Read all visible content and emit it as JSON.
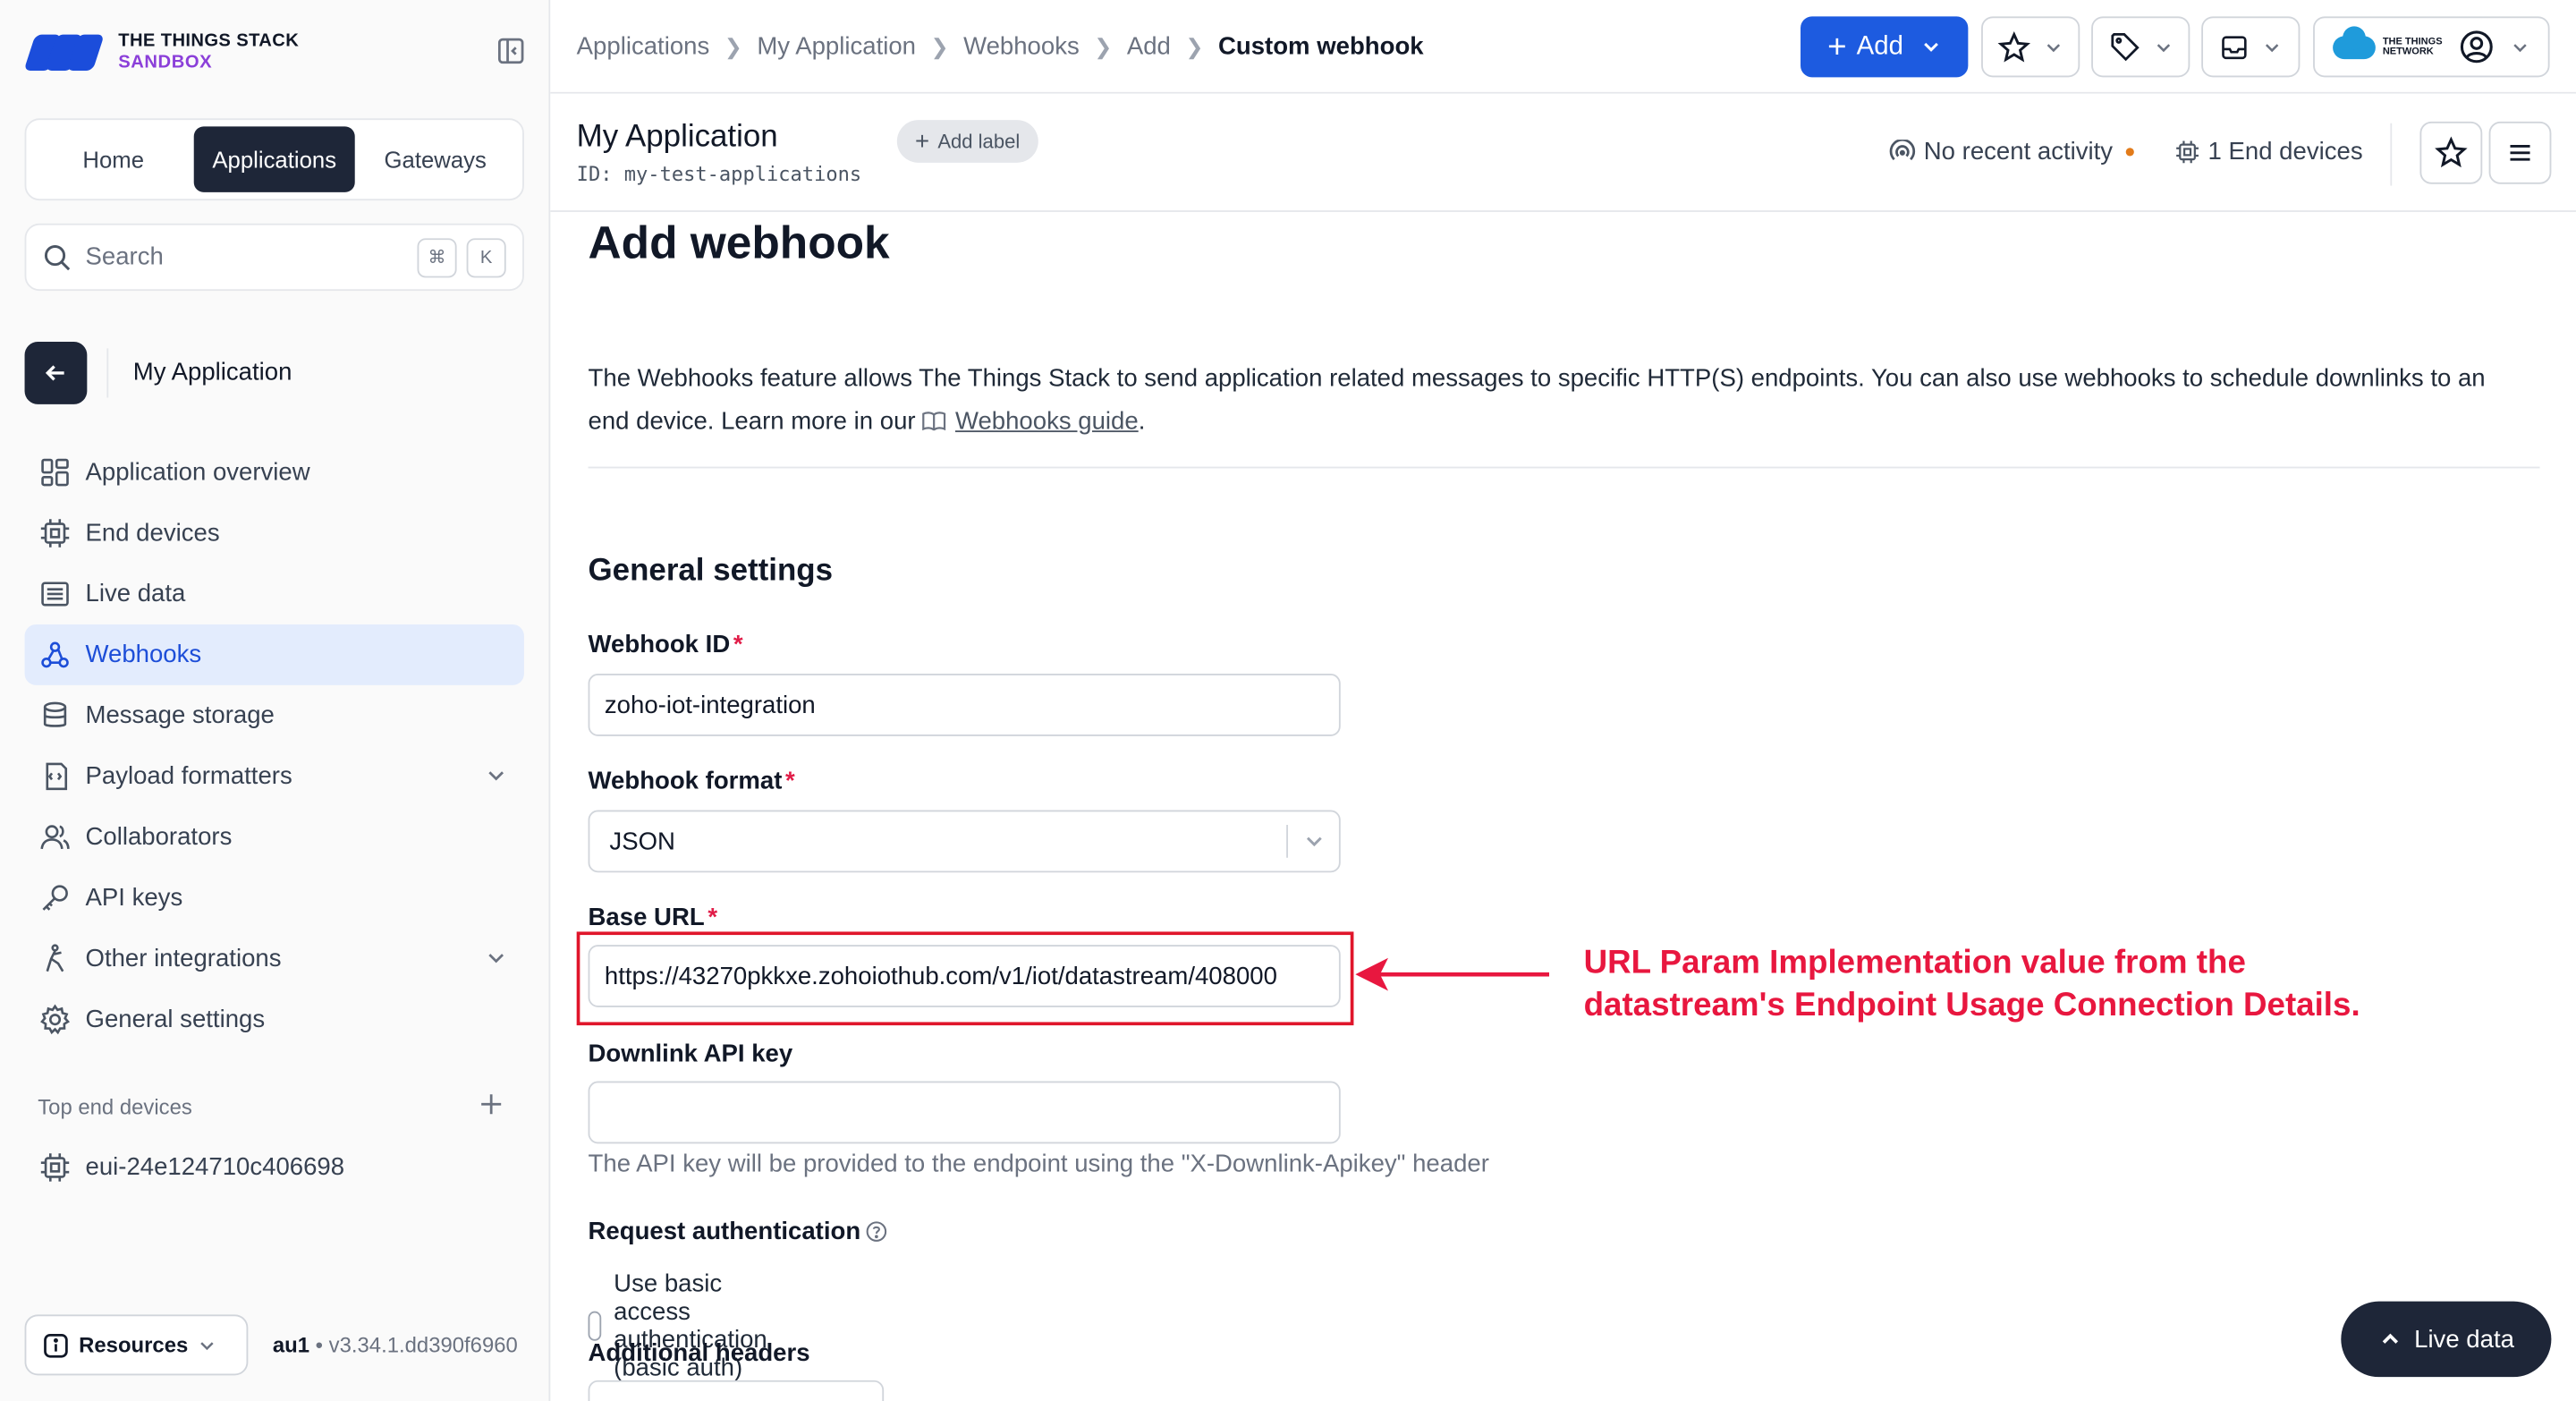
{
  "brand": {
    "line1": "THE THINGS STACK",
    "line2": "SANDBOX",
    "accent": "#1b4ddb",
    "sandbox_color": "#8b3fd9"
  },
  "sidebar": {
    "tabs": [
      {
        "label": "Home",
        "active": false
      },
      {
        "label": "Applications",
        "active": true
      },
      {
        "label": "Gateways",
        "active": false
      }
    ],
    "search": {
      "placeholder": "Search",
      "kbd1": "⌘",
      "kbd2": "K"
    },
    "app_name": "My Application",
    "menu": [
      {
        "label": "Application overview",
        "icon": "grid-icon"
      },
      {
        "label": "End devices",
        "icon": "chip-icon"
      },
      {
        "label": "Live data",
        "icon": "list-icon"
      },
      {
        "label": "Webhooks",
        "icon": "webhook-icon",
        "active": true
      },
      {
        "label": "Message storage",
        "icon": "database-icon"
      },
      {
        "label": "Payload formatters",
        "icon": "code-icon",
        "expandable": true
      },
      {
        "label": "Collaborators",
        "icon": "users-icon"
      },
      {
        "label": "API keys",
        "icon": "key-icon"
      },
      {
        "label": "Other integrations",
        "icon": "integration-icon",
        "expandable": true
      },
      {
        "label": "General settings",
        "icon": "gear-icon"
      }
    ],
    "top_devices_label": "Top end devices",
    "top_device": "eui-24e124710c406698",
    "resources_label": "Resources",
    "version_region": "au1",
    "version_text": " • v3.34.1.dd390f6960"
  },
  "topbar": {
    "breadcrumbs": [
      "Applications",
      "My Application",
      "Webhooks",
      "Add"
    ],
    "current": "Custom webhook",
    "add_label": "Add",
    "ttn_line1": "THE THINGS",
    "ttn_line2": "NETWORK"
  },
  "subheader": {
    "title": "My Application",
    "id": "ID: my-test-applications",
    "add_label": "Add label",
    "activity": "No recent activity",
    "end_devices": "1 End devices"
  },
  "main": {
    "title": "Add webhook",
    "desc_text": "The Webhooks feature allows The Things Stack to send application related messages to specific HTTP(S) endpoints. You can also use webhooks to schedule downlinks to an end device. Learn more in our ",
    "desc_link": "Webhooks guide",
    "desc_end": ".",
    "section": "General settings",
    "webhook_id_label": "Webhook ID",
    "webhook_id_value": "zoho-iot-integration",
    "format_label": "Webhook format",
    "format_value": "JSON",
    "base_url_label": "Base URL",
    "base_url_value": "https://43270pkkxe.zohoiothub.com/v1/iot/datastream/408000",
    "downlink_label": "Downlink API key",
    "downlink_value": "",
    "downlink_hint": "The API key will be provided to the endpoint using the \"X-Downlink-Apikey\" header",
    "auth_label": "Request authentication",
    "basic_auth_label": "Use basic access authentication (basic auth)",
    "headers_label": "Additional headers"
  },
  "annotation": {
    "line1": "URL Param Implementation value from the",
    "line2": "datastream's Endpoint Usage Connection Details.",
    "color": "#e8173f"
  },
  "live_data_button": "Live data"
}
